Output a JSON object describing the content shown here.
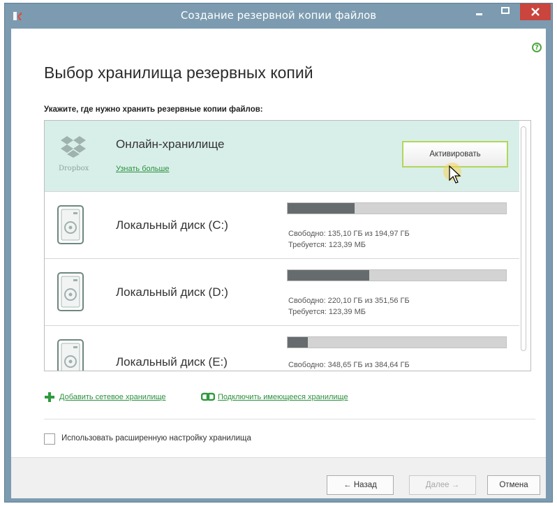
{
  "window": {
    "title": "Создание резервной копии файлов"
  },
  "page": {
    "heading": "Выбор хранилища резервных копий",
    "instruction": "Укажите, где нужно хранить резервные копии файлов:"
  },
  "storages": [
    {
      "type": "online",
      "icon_name": "dropbox-icon",
      "icon_caption": "Dropbox",
      "name": "Онлайн-хранилище",
      "link": "Узнать больше",
      "button": "Активировать",
      "selected": true
    },
    {
      "type": "local",
      "icon_name": "hard-disk-icon",
      "name": "Локальный диск (C:)",
      "free_text": "Свободно: 135,10 ГБ из 194,97 ГБ",
      "required_text": "Требуется: 123,39 МБ",
      "used_fraction": 0.307
    },
    {
      "type": "local",
      "icon_name": "hard-disk-icon",
      "name": "Локальный диск (D:)",
      "free_text": "Свободно: 220,10 ГБ из 351,56 ГБ",
      "required_text": "Требуется: 123,39 МБ",
      "used_fraction": 0.374
    },
    {
      "type": "local",
      "icon_name": "hard-disk-icon",
      "name": "Локальный диск (E:)",
      "free_text": "Свободно: 348,65 ГБ из 384,64 ГБ",
      "used_fraction": 0.094
    }
  ],
  "actions": {
    "add_network": "Добавить сетевое хранилище",
    "connect_existing": "Подключить имеющееся хранилище"
  },
  "advanced": {
    "label": "Использовать расширенную настройку хранилища",
    "checked": false
  },
  "footer": {
    "back": "Назад",
    "next": "Далее",
    "cancel": "Отмена"
  },
  "colors": {
    "selected_row": "#d8efe9",
    "link_green": "#2c8f3d",
    "accent_green": "#4ea541",
    "title_bar": "#7c9bb0",
    "close_red": "#c9453d"
  }
}
